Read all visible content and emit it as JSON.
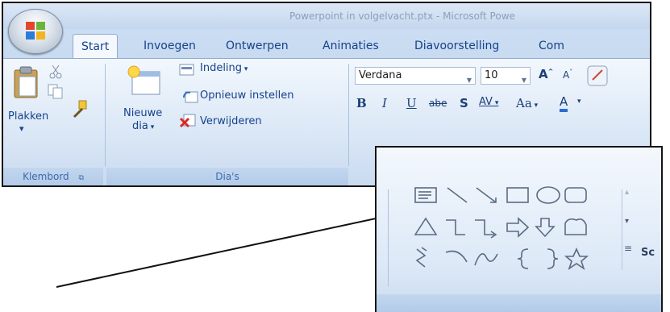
{
  "window": {
    "title": "Powerpoint in volgelvacht.ptx - Microsoft Powe"
  },
  "tabs": [
    {
      "label": "Start",
      "active": true
    },
    {
      "label": "Invoegen",
      "active": false
    },
    {
      "label": "Ontwerpen",
      "active": false
    },
    {
      "label": "Animaties",
      "active": false
    },
    {
      "label": "Diavoorstelling",
      "active": false
    },
    {
      "label": "Com",
      "active": false
    }
  ],
  "clipboard_group": {
    "paste_label": "Plakken",
    "footer_label": "Klembord"
  },
  "slides_group": {
    "new_slide_label_1": "Nieuwe",
    "new_slide_label_2": "dia",
    "layout_label": "Indeling",
    "reset_label": "Opnieuw instellen",
    "delete_label": "Verwijderen",
    "footer_label": "Dia's"
  },
  "font_group": {
    "font_name": "Verdana",
    "font_size": "10",
    "bold": "B",
    "italic": "I",
    "underline": "U",
    "strikethrough": "abe",
    "shadow": "S",
    "spacing": "AV",
    "change_case": "Aa",
    "font_color": "A"
  },
  "inset": {
    "section_label": "Sc",
    "shapes_row1": [
      "text-box",
      "line",
      "arrow-line",
      "rectangle",
      "oval",
      "rounded-rectangle"
    ],
    "shapes_row2": [
      "triangle",
      "elbow-connector",
      "elbow-arrow-connector",
      "right-arrow",
      "down-arrow",
      "callout"
    ],
    "shapes_row3": [
      "freeform",
      "arc",
      "curve",
      "left-brace",
      "right-brace",
      "star"
    ]
  },
  "colors": {
    "ribbon_text": "#15428b",
    "ribbon_bg": "#dae7f6",
    "font_color_underline": "#2a6cd6"
  }
}
